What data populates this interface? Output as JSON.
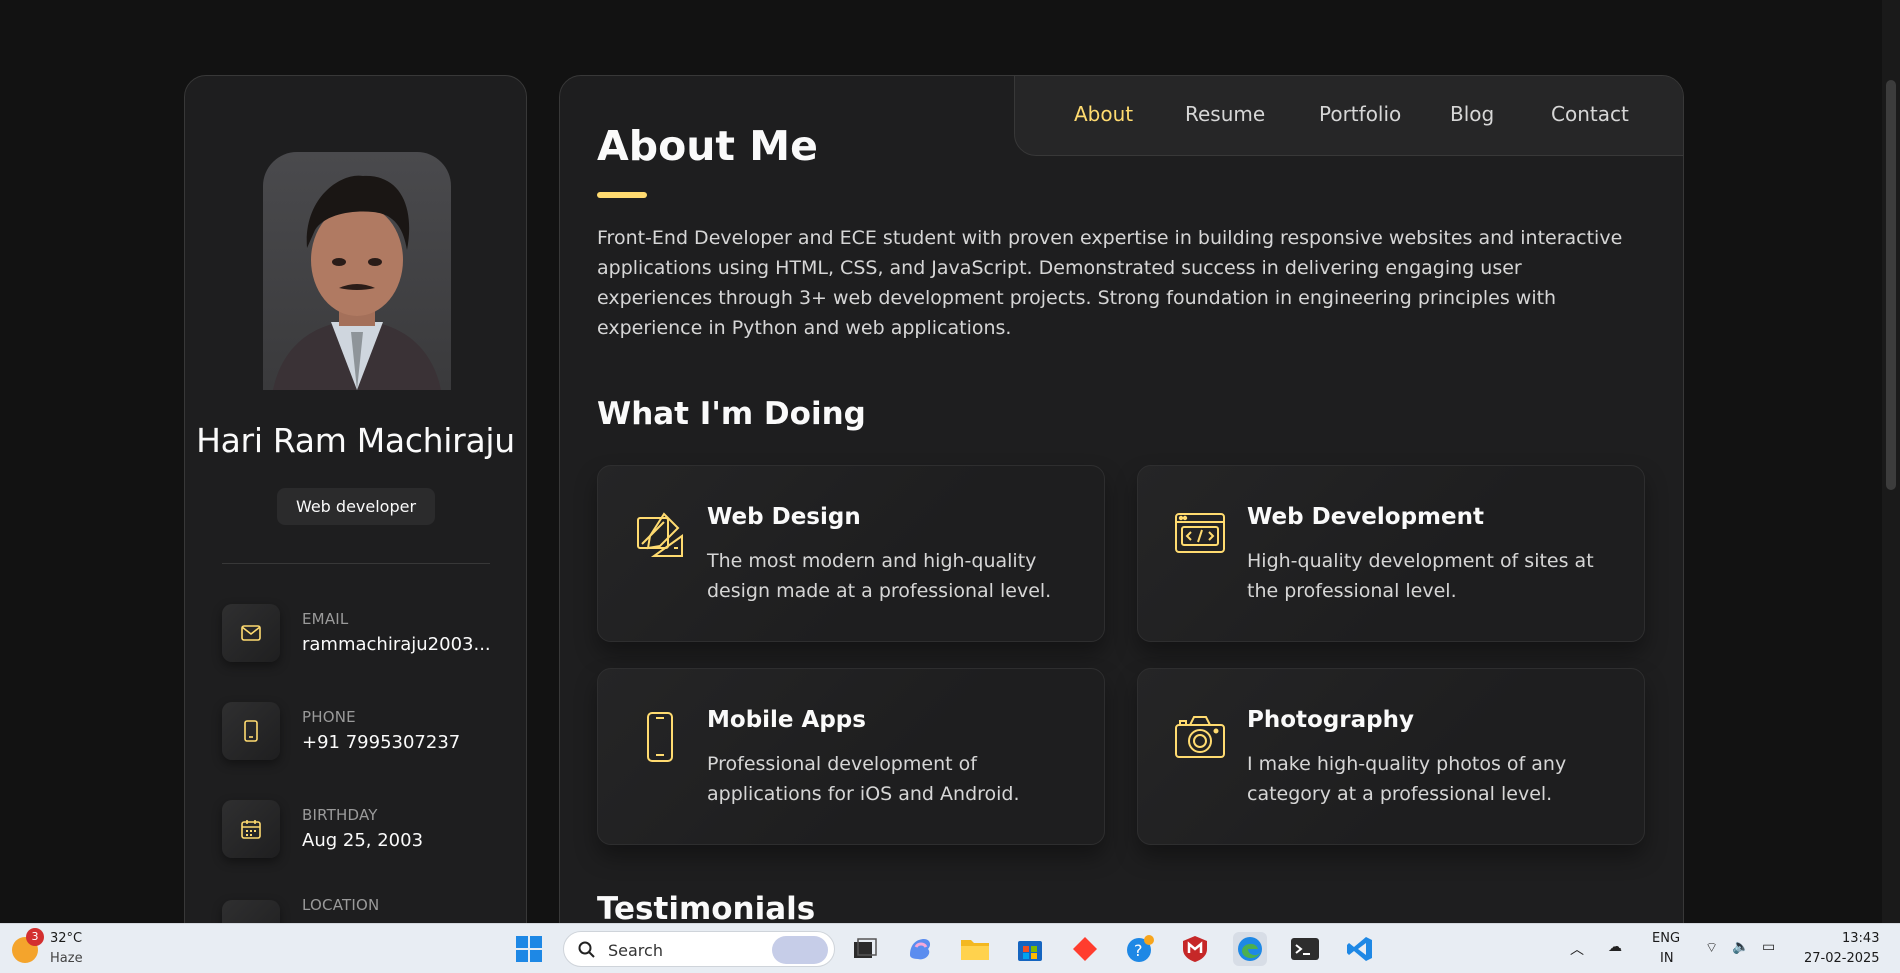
{
  "colors": {
    "accent": "#ffdb70",
    "background": "#121212",
    "card": "#1e1e1f"
  },
  "sidebar": {
    "name": "Hari Ram Machiraju",
    "title": "Web developer",
    "contacts": [
      {
        "label": "EMAIL",
        "value": "rammachiraju2003...",
        "icon": "mail-icon"
      },
      {
        "label": "PHONE",
        "value": "+91 7995307237",
        "icon": "phone-icon"
      },
      {
        "label": "BIRTHDAY",
        "value": "Aug 25, 2003",
        "icon": "calendar-icon"
      },
      {
        "label": "LOCATION",
        "value": "",
        "icon": "location-icon"
      }
    ]
  },
  "nav": {
    "items": [
      {
        "label": "About",
        "active": true
      },
      {
        "label": "Resume",
        "active": false
      },
      {
        "label": "Portfolio",
        "active": false
      },
      {
        "label": "Blog",
        "active": false
      },
      {
        "label": "Contact",
        "active": false
      }
    ]
  },
  "about": {
    "title": "About Me",
    "text": "Front-End Developer and ECE student with proven expertise in building responsive websites and interactive applications using HTML, CSS, and JavaScript. Demonstrated success in delivering engaging user experiences through 3+ web development projects. Strong foundation in engineering principles with experience in Python and web applications."
  },
  "services": {
    "title": "What I'm Doing",
    "items": [
      {
        "title": "Web Design",
        "text": "The most modern and high-quality design made at a professional level.",
        "icon": "design-icon"
      },
      {
        "title": "Web Development",
        "text": "High-quality development of sites at the professional level.",
        "icon": "code-icon"
      },
      {
        "title": "Mobile Apps",
        "text": "Professional development of applications for iOS and Android.",
        "icon": "mobile-icon"
      },
      {
        "title": "Photography",
        "text": "I make high-quality photos of any category at a professional level.",
        "icon": "camera-icon"
      }
    ]
  },
  "testimonials": {
    "title": "Testimonials"
  },
  "taskbar": {
    "weather_temp": "32°C",
    "weather_cond": "Haze",
    "weather_badge": "3",
    "search_placeholder": "Search",
    "lang_line1": "ENG",
    "lang_line2": "IN",
    "time": "13:43",
    "date": "27-02-2025"
  }
}
